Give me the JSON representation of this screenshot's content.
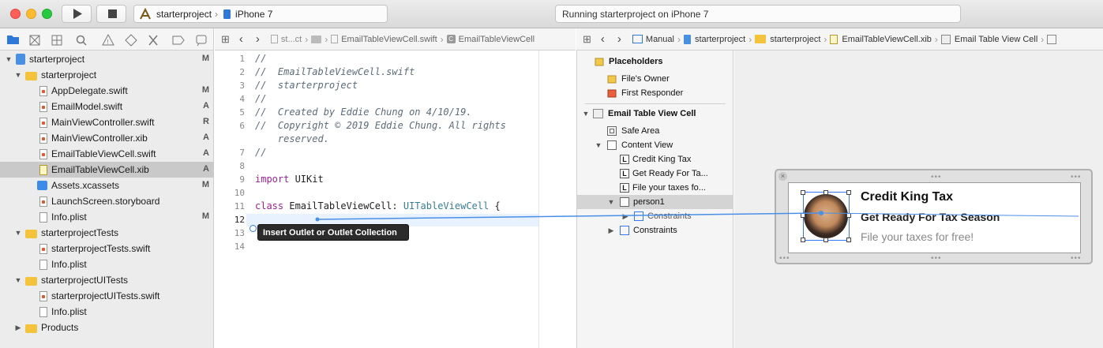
{
  "toolbar": {
    "scheme_project": "starterproject",
    "scheme_device": "iPhone 7",
    "activity_status": "Running starterproject on iPhone 7"
  },
  "editor_jumpbar": {
    "crumb1": "st...ct",
    "crumb2": "EmailTableViewCell.swift",
    "crumb3": "EmailTableViewCell"
  },
  "ib_jumpbar": {
    "manual": "Manual",
    "crumb1": "starterproject",
    "crumb2": "starterproject",
    "crumb3": "EmailTableViewCell.xib",
    "crumb4": "Email Table View Cell"
  },
  "navigator": {
    "items": [
      {
        "label": "starterproject",
        "badge": "M"
      },
      {
        "label": "starterproject",
        "badge": ""
      },
      {
        "label": "AppDelegate.swift",
        "badge": "M"
      },
      {
        "label": "EmailModel.swift",
        "badge": "A"
      },
      {
        "label": "MainViewController.swift",
        "badge": "R"
      },
      {
        "label": "MainViewController.xib",
        "badge": "A"
      },
      {
        "label": "EmailTableViewCell.swift",
        "badge": "A"
      },
      {
        "label": "EmailTableViewCell.xib",
        "badge": "A"
      },
      {
        "label": "Assets.xcassets",
        "badge": "M"
      },
      {
        "label": "LaunchScreen.storyboard",
        "badge": ""
      },
      {
        "label": "Info.plist",
        "badge": "M"
      },
      {
        "label": "starterprojectTests",
        "badge": ""
      },
      {
        "label": "starterprojectTests.swift",
        "badge": ""
      },
      {
        "label": "Info.plist",
        "badge": ""
      },
      {
        "label": "starterprojectUITests",
        "badge": ""
      },
      {
        "label": "starterprojectUITests.swift",
        "badge": ""
      },
      {
        "label": "Info.plist",
        "badge": ""
      },
      {
        "label": "Products",
        "badge": ""
      }
    ]
  },
  "code": {
    "line_numbers": [
      "1",
      "2",
      "3",
      "4",
      "5",
      "6",
      "",
      "7",
      "8",
      "9",
      "10",
      "11",
      "12",
      "13",
      "14"
    ],
    "l1": "//",
    "l2": "//  EmailTableViewCell.swift",
    "l3": "//  starterproject",
    "l4": "//",
    "l5": "//  Created by Eddie Chung on 4/10/19.",
    "l6a": "//  Copyright © 2019 Eddie Chung. All rights",
    "l6b": "    reserved.",
    "l7": "//",
    "l9_kw": "import",
    "l9_rest": " UIKit",
    "l11_kw": "class",
    "l11_name": " EmailTableViewCell: ",
    "l11_type": "UITableViewCell",
    "l11_end": " {"
  },
  "tooltip": "Insert Outlet or Outlet Collection",
  "outline": {
    "placeholders": "Placeholders",
    "files_owner": "File's Owner",
    "first_responder": "First Responder",
    "cell": "Email Table View Cell",
    "safe_area": "Safe Area",
    "content_view": "Content View",
    "label1": "Credit King Tax",
    "label2": "Get Ready For Ta...",
    "label3": "File your taxes fo...",
    "person": "person1",
    "constraints_inner": "Constraints",
    "constraints": "Constraints",
    "label_glyph": "L"
  },
  "cell_preview": {
    "title": "Credit King Tax",
    "subtitle": "Get Ready For Tax Season",
    "body": "File your taxes for free!"
  },
  "colors": {
    "accent": "#3478f6",
    "selection": "#c9c9c9",
    "connection_line": "#4a8fe7"
  }
}
